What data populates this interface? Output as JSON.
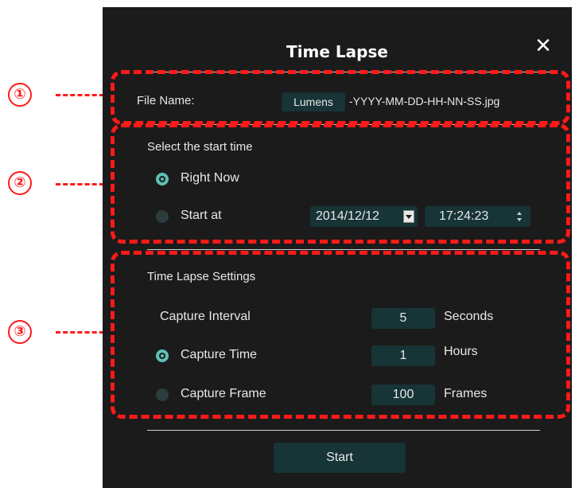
{
  "dialog": {
    "title": "Time Lapse",
    "close_glyph": "✕"
  },
  "file_name": {
    "label": "File Name:",
    "prefix": "Lumens",
    "suffix": "-YYYY-MM-DD-HH-NN-SS.jpg"
  },
  "start_time": {
    "heading": "Select the start time",
    "right_now_label": "Right Now",
    "start_at_label": "Start at",
    "selected": "Right Now",
    "date": "2014/12/12",
    "time": "17:24:23"
  },
  "settings": {
    "heading": "Time Lapse Settings",
    "capture_interval": {
      "label": "Capture Interval",
      "value": "5",
      "unit": "Seconds"
    },
    "capture_time": {
      "label": "Capture Time",
      "value": "1",
      "unit": "Hours"
    },
    "capture_frame": {
      "label": "Capture Frame",
      "value": "100",
      "unit": "Frames"
    },
    "selected": "Capture Time"
  },
  "start_button": "Start",
  "callouts": [
    "①",
    "②",
    "③"
  ],
  "colors": {
    "background": "#1b1b1b",
    "field": "#173436",
    "radio_on": "#5fbfb5",
    "callout": "#ff1a1a"
  }
}
